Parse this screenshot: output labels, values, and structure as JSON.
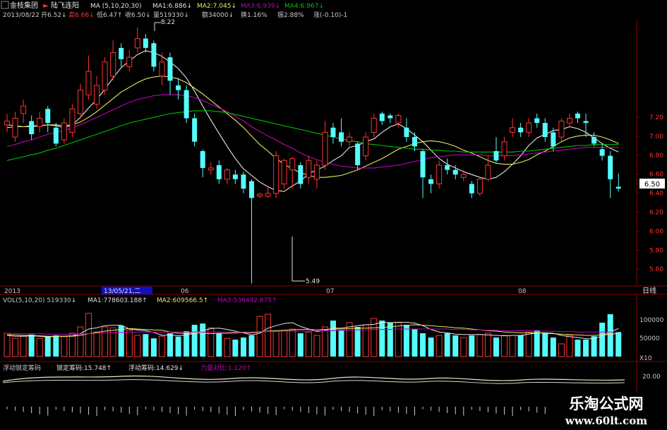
{
  "header": {
    "stock": "金枝集团",
    "indicator": "陆飞连阳",
    "date": "2013/08/22",
    "ma_title": "MA (5,10,20,30)",
    "ma1": "MA1:6.886↓",
    "ma2": "MA2:7.045↓",
    "ma3": "MA3:6.939↓",
    "ma4": "MA4:6.967↓",
    "open": "开6.52↓",
    "high": "高6.66↓",
    "low": "低6.47↑",
    "close": "收6.50↓",
    "volume": "量519330↓",
    "amount": "额34000↓",
    "turnover": "换1.16%",
    "amplitude": "振2.88%",
    "change": "涨(-0.10)-1"
  },
  "price_axis_labels": [
    "7.20",
    "7.00",
    "6.80",
    "6.60",
    "6.40",
    "6.20",
    "6.00",
    "5.80",
    "5.60"
  ],
  "current_price": "6.50",
  "annotations": {
    "high": "8.22",
    "low": "5.49"
  },
  "time_axis": {
    "year": "2013",
    "cursor": "13/05/21,二",
    "m06": "06",
    "m07": "07",
    "m08": "08",
    "period": "日线"
  },
  "volume_panel": {
    "title": "VOL(5,10,20) 519330↓",
    "ma1": "MA1:778603.188↑",
    "ma2": "MA2:609566.5↑",
    "ma3": "MA3:536492.875↑",
    "labels": [
      "100000",
      "50000",
      "X10"
    ]
  },
  "chip_panel": {
    "title": "浮动锁定筹码",
    "lock": "锁定筹码:15.748↑",
    "float": "浮动筹码:14.629↓",
    "power": "力量对比:1.120↑",
    "label": "20.00"
  },
  "watermark": {
    "line1": "乐淘公式网",
    "line2": "www.60lt.com"
  },
  "colors": {
    "up": "#ff3333",
    "down": "#54fcfc",
    "ma1": "#e6e6e6",
    "ma2": "#e8e860",
    "ma3": "#c000c0",
    "ma4": "#00c000"
  },
  "chart_data": {
    "type": "candlestick",
    "y_range": [
      5.5,
      7.35
    ],
    "candles": [
      {
        "o": 7.18,
        "c": 7.22,
        "h": 7.3,
        "l": 7.1
      },
      {
        "o": 7.05,
        "c": 7.25,
        "h": 7.32,
        "l": 7.0
      },
      {
        "o": 7.3,
        "c": 7.38,
        "h": 7.45,
        "l": 7.2
      },
      {
        "o": 7.22,
        "c": 7.08,
        "h": 7.28,
        "l": 7.02
      },
      {
        "o": 7.16,
        "c": 7.25,
        "h": 7.32,
        "l": 7.1
      },
      {
        "o": 7.35,
        "c": 7.2,
        "h": 7.38,
        "l": 7.1
      },
      {
        "o": 7.15,
        "c": 6.98,
        "h": 7.2,
        "l": 6.95
      },
      {
        "o": 7.02,
        "c": 7.2,
        "h": 7.25,
        "l": 6.98
      },
      {
        "o": 7.1,
        "c": 7.35,
        "h": 7.4,
        "l": 7.05
      },
      {
        "o": 7.3,
        "c": 7.55,
        "h": 7.62,
        "l": 7.25
      },
      {
        "o": 7.5,
        "c": 7.75,
        "h": 7.92,
        "l": 7.45
      },
      {
        "o": 7.4,
        "c": 7.6,
        "h": 7.7,
        "l": 7.35
      },
      {
        "o": 7.55,
        "c": 7.85,
        "h": 7.9,
        "l": 7.5
      },
      {
        "o": 7.7,
        "c": 7.95,
        "h": 8.08,
        "l": 7.65
      },
      {
        "o": 8.0,
        "c": 7.88,
        "h": 8.05,
        "l": 7.8
      },
      {
        "o": 7.8,
        "c": 7.9,
        "h": 7.98,
        "l": 7.75
      },
      {
        "o": 8.0,
        "c": 8.1,
        "h": 8.22,
        "l": 7.95
      },
      {
        "o": 8.1,
        "c": 8.0,
        "h": 8.15,
        "l": 7.95
      },
      {
        "o": 8.05,
        "c": 7.8,
        "h": 8.08,
        "l": 7.75
      },
      {
        "o": 7.7,
        "c": 7.85,
        "h": 7.95,
        "l": 7.6
      },
      {
        "o": 7.9,
        "c": 7.65,
        "h": 7.95,
        "l": 7.5
      },
      {
        "o": 7.6,
        "c": 7.55,
        "h": 7.68,
        "l": 7.45
      },
      {
        "o": 7.55,
        "c": 7.25,
        "h": 7.6,
        "l": 7.2
      },
      {
        "o": 7.25,
        "c": 7.0,
        "h": 7.3,
        "l": 6.95
      },
      {
        "o": 6.9,
        "c": 6.72,
        "h": 6.92,
        "l": 6.62
      },
      {
        "o": 6.7,
        "c": 6.72,
        "h": 6.78,
        "l": 6.65
      },
      {
        "o": 6.75,
        "c": 6.6,
        "h": 6.8,
        "l": 6.55
      },
      {
        "o": 6.6,
        "c": 6.7,
        "h": 6.72,
        "l": 6.55
      },
      {
        "o": 6.65,
        "c": 6.6,
        "h": 6.7,
        "l": 6.55
      },
      {
        "o": 6.65,
        "c": 6.5,
        "h": 6.68,
        "l": 6.45
      },
      {
        "o": 6.58,
        "c": 6.4,
        "h": 6.6,
        "l": 5.49
      },
      {
        "o": 6.42,
        "c": 6.44,
        "h": 6.46,
        "l": 6.4
      },
      {
        "o": 6.42,
        "c": 6.45,
        "h": 6.52,
        "l": 6.4
      },
      {
        "o": 6.45,
        "c": 6.85,
        "h": 6.9,
        "l": 6.4
      },
      {
        "o": 6.55,
        "c": 6.8,
        "h": 6.82,
        "l": 6.5
      },
      {
        "o": 6.7,
        "c": 6.82,
        "h": 6.84,
        "l": 6.5
      },
      {
        "o": 6.75,
        "c": 6.55,
        "h": 6.78,
        "l": 6.5
      },
      {
        "o": 6.62,
        "c": 6.8,
        "h": 6.85,
        "l": 6.55
      },
      {
        "o": 6.6,
        "c": 6.75,
        "h": 6.8,
        "l": 6.5
      },
      {
        "o": 6.75,
        "c": 7.1,
        "h": 7.22,
        "l": 6.7
      },
      {
        "o": 7.15,
        "c": 7.05,
        "h": 7.2,
        "l": 6.98
      },
      {
        "o": 7.1,
        "c": 7.0,
        "h": 7.25,
        "l": 6.95
      },
      {
        "o": 7.0,
        "c": 7.05,
        "h": 7.1,
        "l": 6.95
      },
      {
        "o": 6.98,
        "c": 6.75,
        "h": 7.0,
        "l": 6.7
      },
      {
        "o": 6.85,
        "c": 7.05,
        "h": 7.1,
        "l": 6.8
      },
      {
        "o": 7.1,
        "c": 7.25,
        "h": 7.3,
        "l": 7.05
      },
      {
        "o": 7.3,
        "c": 7.22,
        "h": 7.32,
        "l": 7.18
      },
      {
        "o": 7.28,
        "c": 7.25,
        "h": 7.3,
        "l": 7.2
      },
      {
        "o": 7.2,
        "c": 7.28,
        "h": 7.3,
        "l": 7.15
      },
      {
        "o": 7.15,
        "c": 7.05,
        "h": 7.25,
        "l": 7.0
      },
      {
        "o": 7.05,
        "c": 6.95,
        "h": 7.1,
        "l": 6.9
      },
      {
        "o": 6.9,
        "c": 6.62,
        "h": 6.92,
        "l": 6.4
      },
      {
        "o": 6.6,
        "c": 6.55,
        "h": 6.65,
        "l": 6.45
      },
      {
        "o": 6.55,
        "c": 6.75,
        "h": 6.8,
        "l": 6.5
      },
      {
        "o": 6.75,
        "c": 6.7,
        "h": 6.82,
        "l": 6.65
      },
      {
        "o": 6.7,
        "c": 6.65,
        "h": 6.75,
        "l": 6.6
      },
      {
        "o": 6.62,
        "c": 6.65,
        "h": 6.7,
        "l": 6.58
      },
      {
        "o": 6.55,
        "c": 6.45,
        "h": 6.58,
        "l": 6.4
      },
      {
        "o": 6.45,
        "c": 6.6,
        "h": 6.62,
        "l": 6.42
      },
      {
        "o": 6.6,
        "c": 6.75,
        "h": 6.85,
        "l": 6.58
      },
      {
        "o": 6.9,
        "c": 6.8,
        "h": 7.05,
        "l": 6.78
      },
      {
        "o": 6.85,
        "c": 7.0,
        "h": 7.05,
        "l": 6.8
      },
      {
        "o": 7.1,
        "c": 7.15,
        "h": 7.25,
        "l": 7.05
      },
      {
        "o": 7.15,
        "c": 7.1,
        "h": 7.2,
        "l": 7.05
      },
      {
        "o": 7.1,
        "c": 7.2,
        "h": 7.25,
        "l": 7.05
      },
      {
        "o": 7.25,
        "c": 7.2,
        "h": 7.3,
        "l": 7.15
      },
      {
        "o": 7.2,
        "c": 7.05,
        "h": 7.25,
        "l": 7.0
      },
      {
        "o": 7.1,
        "c": 6.95,
        "h": 7.15,
        "l": 6.9
      },
      {
        "o": 7.05,
        "c": 7.22,
        "h": 7.25,
        "l": 7.0
      },
      {
        "o": 7.2,
        "c": 7.25,
        "h": 7.3,
        "l": 7.15
      },
      {
        "o": 7.3,
        "c": 7.25,
        "h": 7.32,
        "l": 7.2
      },
      {
        "o": 7.22,
        "c": 7.2,
        "h": 7.3,
        "l": 7.05
      },
      {
        "o": 7.05,
        "c": 6.98,
        "h": 7.1,
        "l": 6.95
      },
      {
        "o": 6.92,
        "c": 6.85,
        "h": 6.98,
        "l": 6.8
      },
      {
        "o": 6.85,
        "c": 6.6,
        "h": 6.9,
        "l": 6.4
      },
      {
        "o": 6.52,
        "c": 6.5,
        "h": 6.66,
        "l": 6.47
      }
    ],
    "ma": {
      "MA1": [
        7.18,
        7.17,
        7.16,
        7.16,
        7.17,
        7.18,
        7.17,
        7.15,
        7.18,
        7.26,
        7.36,
        7.45,
        7.56,
        7.68,
        7.79,
        7.86,
        7.93,
        7.97,
        7.95,
        7.91,
        7.85,
        7.78,
        7.68,
        7.54,
        7.38,
        7.23,
        7.09,
        6.95,
        6.82,
        6.71,
        6.64,
        6.57,
        6.52,
        6.48,
        6.47,
        6.53,
        6.58,
        6.66,
        6.7,
        6.74,
        6.8,
        6.85,
        6.94,
        6.96,
        7.0,
        7.03,
        7.1,
        7.16,
        7.19,
        7.14,
        7.07,
        7.0,
        6.91,
        6.82,
        6.76,
        6.72,
        6.68,
        6.65,
        6.62,
        6.6,
        6.62,
        6.68,
        6.76,
        6.85,
        6.96,
        7.04,
        7.08,
        7.12,
        7.13,
        7.16,
        7.14,
        7.1,
        7.04,
        6.98,
        6.93,
        6.89
      ],
      "MA2": [
        7.15,
        7.16,
        7.16,
        7.17,
        7.17,
        7.18,
        7.18,
        7.17,
        7.18,
        7.21,
        7.26,
        7.32,
        7.39,
        7.46,
        7.53,
        7.58,
        7.63,
        7.67,
        7.69,
        7.7,
        7.69,
        7.67,
        7.63,
        7.57,
        7.51,
        7.44,
        7.37,
        7.3,
        7.23,
        7.15,
        7.06,
        6.97,
        6.9,
        6.82,
        6.76,
        6.71,
        6.67,
        6.64,
        6.62,
        6.62,
        6.63,
        6.64,
        6.67,
        6.7,
        6.74,
        6.78,
        6.82,
        6.87,
        6.92,
        6.95,
        6.98,
        7.0,
        7.01,
        7.0,
        6.98,
        6.95,
        6.91,
        6.88,
        6.84,
        6.8,
        6.77,
        6.76,
        6.76,
        6.78,
        6.81,
        6.86,
        6.9,
        6.95,
        7.0,
        7.04,
        7.06,
        7.07,
        7.07,
        7.05,
        7.02,
        6.98
      ],
      "MA3": [
        6.95,
        6.97,
        7.0,
        7.02,
        7.05,
        7.08,
        7.1,
        7.12,
        7.15,
        7.18,
        7.22,
        7.26,
        7.3,
        7.34,
        7.38,
        7.42,
        7.45,
        7.47,
        7.49,
        7.5,
        7.5,
        7.5,
        7.49,
        7.47,
        7.44,
        7.4,
        7.36,
        7.32,
        7.27,
        7.22,
        7.16,
        7.11,
        7.06,
        7.02,
        6.97,
        6.93,
        6.88,
        6.84,
        6.81,
        6.78,
        6.76,
        6.74,
        6.73,
        6.72,
        6.72,
        6.72,
        6.73,
        6.74,
        6.75,
        6.77,
        6.79,
        6.81,
        6.83,
        6.84,
        6.85,
        6.86,
        6.86,
        6.86,
        6.86,
        6.85,
        6.85,
        6.85,
        6.85,
        6.86,
        6.87,
        6.88,
        6.89,
        6.9,
        6.91,
        6.92,
        6.93,
        6.94,
        6.94,
        6.94,
        6.94,
        6.94
      ],
      "MA4": [
        6.8,
        6.82,
        6.84,
        6.86,
        6.88,
        6.91,
        6.93,
        6.96,
        6.99,
        7.02,
        7.05,
        7.08,
        7.11,
        7.14,
        7.17,
        7.2,
        7.22,
        7.24,
        7.26,
        7.28,
        7.3,
        7.31,
        7.32,
        7.33,
        7.33,
        7.33,
        7.32,
        7.31,
        7.29,
        7.27,
        7.25,
        7.23,
        7.21,
        7.19,
        7.17,
        7.15,
        7.13,
        7.11,
        7.09,
        7.07,
        7.05,
        7.03,
        7.01,
        7.0,
        6.98,
        6.97,
        6.96,
        6.95,
        6.94,
        6.93,
        6.92,
        6.92,
        6.91,
        6.91,
        6.9,
        6.9,
        6.89,
        6.89,
        6.89,
        6.89,
        6.89,
        6.89,
        6.89,
        6.9,
        6.9,
        6.91,
        6.92,
        6.93,
        6.94,
        6.95,
        6.96,
        6.96,
        6.97,
        6.97,
        6.97,
        6.97
      ]
    },
    "volume": [
      55,
      43,
      50,
      52,
      43,
      48,
      50,
      47,
      55,
      70,
      102,
      58,
      70,
      68,
      73,
      62,
      50,
      53,
      43,
      48,
      55,
      47,
      60,
      75,
      78,
      68,
      55,
      43,
      40,
      45,
      50,
      95,
      100,
      60,
      62,
      65,
      55,
      58,
      50,
      70,
      85,
      62,
      80,
      70,
      75,
      90,
      85,
      80,
      80,
      75,
      65,
      55,
      45,
      50,
      55,
      50,
      45,
      50,
      52,
      55,
      45,
      50,
      50,
      50,
      58,
      62,
      55,
      45,
      30,
      50,
      40,
      40,
      48,
      80,
      100,
      58
    ],
    "volume_ma": [
      [
        50,
        48,
        48,
        49,
        48,
        46,
        48,
        48,
        49,
        54,
        65,
        68,
        73,
        74,
        74,
        65,
        63,
        61,
        57,
        50,
        51,
        49,
        51,
        55,
        61,
        66,
        67,
        64,
        60,
        56,
        51,
        55,
        67,
        73,
        78,
        80,
        71,
        65,
        59,
        62,
        67,
        67,
        70,
        73,
        75,
        76,
        81,
        80,
        81,
        81,
        79,
        73,
        64,
        58,
        56,
        53,
        52,
        52,
        52,
        51,
        50,
        49,
        50,
        50,
        53,
        56,
        56,
        55,
        50,
        47,
        45,
        42,
        42,
        49,
        59,
        66
      ],
      [
        52,
        51,
        50,
        50,
        49,
        48,
        48,
        48,
        48,
        50,
        54,
        57,
        60,
        62,
        64,
        66,
        65,
        64,
        63,
        62,
        58,
        55,
        55,
        56,
        55,
        54,
        55,
        55,
        56,
        57,
        56,
        58,
        60,
        61,
        62,
        63,
        64,
        64,
        63,
        64,
        65,
        65,
        66,
        67,
        67,
        68,
        69,
        70,
        72,
        74,
        75,
        74,
        73,
        71,
        70,
        68,
        67,
        65,
        63,
        61,
        60,
        58,
        57,
        56,
        56,
        56,
        55,
        54,
        53,
        52,
        51,
        50,
        50,
        51,
        52,
        55
      ],
      [
        55,
        55,
        54,
        54,
        54,
        53,
        53,
        53,
        53,
        53,
        54,
        55,
        56,
        57,
        57,
        58,
        58,
        58,
        58,
        58,
        58,
        58,
        58,
        58,
        58,
        58,
        58,
        58,
        58,
        58,
        58,
        59,
        59,
        59,
        60,
        60,
        60,
        60,
        61,
        61,
        61,
        62,
        62,
        63,
        63,
        64,
        64,
        64,
        65,
        65,
        65,
        65,
        65,
        65,
        65,
        64,
        64,
        63,
        63,
        62,
        62,
        61,
        61,
        61,
        61,
        60,
        60,
        60,
        59,
        59,
        58,
        58,
        58,
        58,
        58,
        58
      ]
    ]
  }
}
